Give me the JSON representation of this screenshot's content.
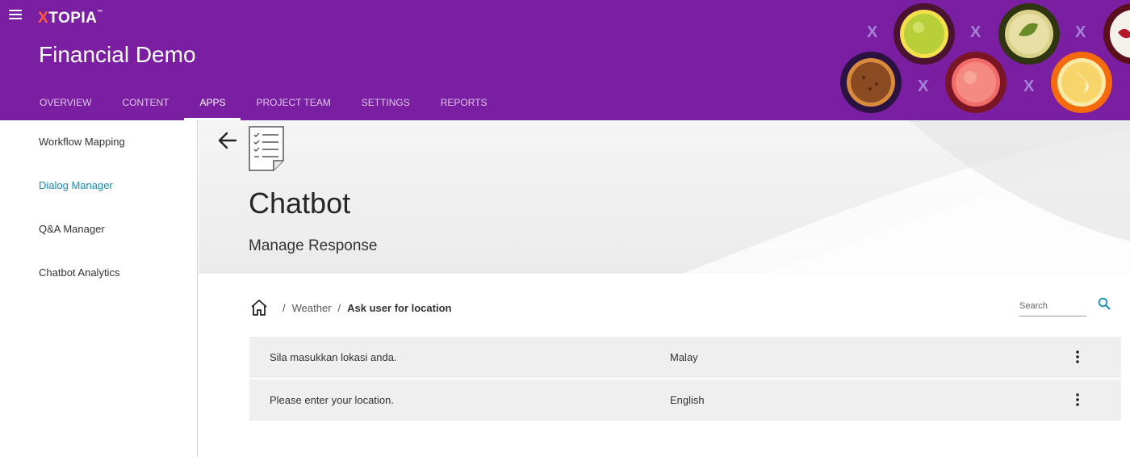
{
  "brand": {
    "logo_prefix": "X",
    "logo_rest": "TOPIA",
    "logo_tm": "™"
  },
  "header": {
    "title": "Financial Demo"
  },
  "tabs": [
    {
      "label": "OVERVIEW",
      "active": false
    },
    {
      "label": "CONTENT",
      "active": false
    },
    {
      "label": "APPS",
      "active": true
    },
    {
      "label": "PROJECT TEAM",
      "active": false
    },
    {
      "label": "SETTINGS",
      "active": false
    },
    {
      "label": "REPORTS",
      "active": false
    }
  ],
  "sidebar": {
    "items": [
      {
        "label": "Workflow Mapping",
        "active": false
      },
      {
        "label": "Dialog Manager",
        "active": true
      },
      {
        "label": "Q&A Manager",
        "active": false
      },
      {
        "label": "Chatbot Analytics",
        "active": false
      }
    ]
  },
  "hero": {
    "title": "Chatbot",
    "subtitle": "Manage Response"
  },
  "breadcrumb": {
    "separator": "/",
    "items": [
      "Weather",
      "Ask user for location"
    ]
  },
  "search": {
    "placeholder": "Search",
    "value": ""
  },
  "responses": [
    {
      "text": "Sila masukkan lokasi anda.",
      "language": "Malay"
    },
    {
      "text": "Please enter your location.",
      "language": "English"
    }
  ],
  "colors": {
    "header": "#7b1fa2",
    "accent": "#1a8bb5",
    "logo_x": "#ff5a3c",
    "row_bg": "#efefef"
  },
  "icons": [
    "menu-icon",
    "back-arrow-icon",
    "document-checklist-icon",
    "home-icon",
    "search-icon",
    "more-vert-icon"
  ]
}
